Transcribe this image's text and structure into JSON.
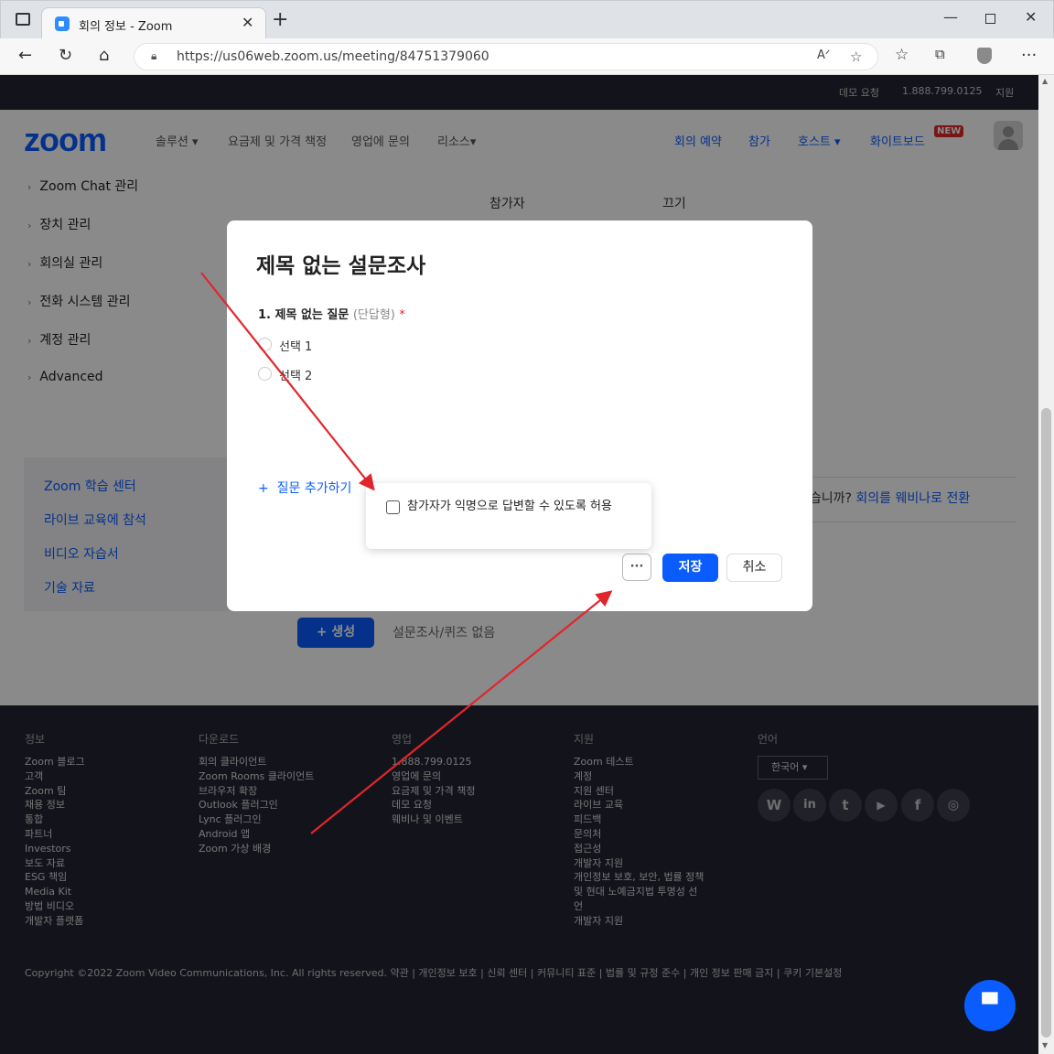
{
  "browser": {
    "tab_title": "회의 정보 - Zoom",
    "url": "https://us06web.zoom.us/meeting/84751379060"
  },
  "topbar": {
    "demo": "데모 요청",
    "phone": "1.888.799.0125",
    "support": "지원"
  },
  "nav": {
    "logo": "zoom",
    "solutions": "솔루션",
    "pricing": "요금제 및 가격 책정",
    "sales": "영업에 문의",
    "resources": "리소스",
    "schedule": "회의 예약",
    "join": "참가",
    "host": "호스트",
    "whiteboard": "화이트보드",
    "new_badge": "NEW"
  },
  "sidebar": {
    "items": [
      "Zoom Chat 관리",
      "장치 관리",
      "회의실 관리",
      "전화 시스템 관리",
      "계정 관리",
      "Advanced"
    ],
    "learn": [
      "Zoom 학습 센터",
      "라이브 교육에 참석",
      "비디오 자습서",
      "기술 자료"
    ]
  },
  "background": {
    "participant": "참가자",
    "off": "끄기",
    "webinar_q": "겠습니까?",
    "webinar_link": "회의를 웨비나로 전환",
    "create": "생성",
    "no_polls": "설문조사/퀴즈 없음"
  },
  "modal": {
    "title": "제목 없는 설문조사",
    "question": "1. 제목 없는 질문",
    "question_type": "(단답형)",
    "required_mark": "*",
    "options": [
      "선택 1",
      "선택 2"
    ],
    "add_question": "질문 추가하기",
    "more": "···",
    "save": "저장",
    "cancel": "취소"
  },
  "popover": {
    "anonymous_label": "참가자가 익명으로 답변할 수 있도록 허용"
  },
  "footer": {
    "columns": [
      {
        "heading": "정보",
        "links": [
          "Zoom 블로그",
          "고객",
          "Zoom 팀",
          "채용 정보",
          "통합",
          "파트너",
          "Investors",
          "보도 자료",
          "ESG 책임",
          "Media Kit",
          "방법 비디오",
          "개발자 플랫폼"
        ]
      },
      {
        "heading": "다운로드",
        "links": [
          "회의 클라이언트",
          "Zoom Rooms 클라이언트",
          "브라우저 확장",
          "Outlook 플러그인",
          "Lync 플러그인",
          "Android 앱",
          "Zoom 가상 배경"
        ]
      },
      {
        "heading": "영업",
        "links": [
          "1.888.799.0125",
          "영업에 문의",
          "요금제 및 가격 책정",
          "데모 요청",
          "웨비나 및 이벤트"
        ]
      },
      {
        "heading": "지원",
        "links": [
          "Zoom 테스트",
          "계정",
          "지원 센터",
          "라이브 교육",
          "피드백",
          "문의처",
          "접근성",
          "개발자 지원",
          "개인정보 보호, 보안, 법률 정책",
          "및 현대 노예금지법 투명성 선",
          "언",
          "개발자 지원"
        ]
      }
    ],
    "language_heading": "언어",
    "language": "한국어",
    "social": [
      "wordpress-icon",
      "linkedin-icon",
      "twitter-icon",
      "youtube-icon",
      "facebook-icon",
      "instagram-icon"
    ],
    "copyright": "Copyright ©2022 Zoom Video Communications, Inc. All rights reserved.  약관  |  개인정보 보호  |  신뢰 센터  |  커뮤니티 표준  |  법률 및 규정 준수  |  개인 정보 판매 금지  |  쿠키 기본설정"
  },
  "annotations": {
    "arrow_color": "#e0262b"
  }
}
